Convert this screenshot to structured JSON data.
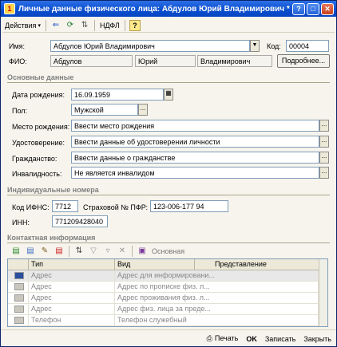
{
  "window": {
    "title": "Личные данные физического лица: Абдулов Юрий Владимирович *"
  },
  "toolbar": {
    "actions_label": "Действия",
    "ndfl_label": "НДФЛ",
    "help_label": "?"
  },
  "header": {
    "name_label": "Имя:",
    "name_value": "Абдулов Юрий Владимирович",
    "code_label": "Код:",
    "code_value": "00004",
    "fio_label": "ФИО:",
    "surname": "Абдулов",
    "first_name": "Юрий",
    "patronymic": "Владимирович",
    "details_button": "Подробнее..."
  },
  "basic": {
    "section_title": "Основные данные",
    "birth_label": "Дата рождения:",
    "birth_value": "16.09.1959",
    "gender_label": "Пол:",
    "gender_value": "Мужской",
    "birthplace_label": "Место рождения:",
    "birthplace_value": "Ввести место рождения",
    "id_label": "Удостоверение:",
    "id_value": "Ввести данные об удостоверении личности",
    "citizenship_label": "Гражданство:",
    "citizenship_value": "Ввести данные о гражданстве",
    "disability_label": "Инвалидность:",
    "disability_value": "Не является инвалидом"
  },
  "ids": {
    "section_title": "Индивидуальные номера",
    "ifns_label": "Код ИФНС:",
    "ifns_value": "7712",
    "pfr_label": "Страховой № ПФР:",
    "pfr_value": "123-006-177 94",
    "inn_label": "ИНН:",
    "inn_value": "771209428040"
  },
  "contacts": {
    "section_title": "Контактная информация",
    "main_label": "Основная",
    "columns": [
      "Тип",
      "Вид",
      "Представление"
    ],
    "rows": [
      {
        "type": "Адрес",
        "kind": "Адрес для информировани..."
      },
      {
        "type": "Адрес",
        "kind": "Адрес по прописке физ. л..."
      },
      {
        "type": "Адрес",
        "kind": "Адрес проживания физ. л..."
      },
      {
        "type": "Адрес",
        "kind": "Адрес физ. лица за преде..."
      },
      {
        "type": "Телефон",
        "kind": "Телефон служебный"
      }
    ]
  },
  "footer": {
    "print": "Печать",
    "ok": "OK",
    "save": "Записать",
    "close": "Закрыть"
  }
}
